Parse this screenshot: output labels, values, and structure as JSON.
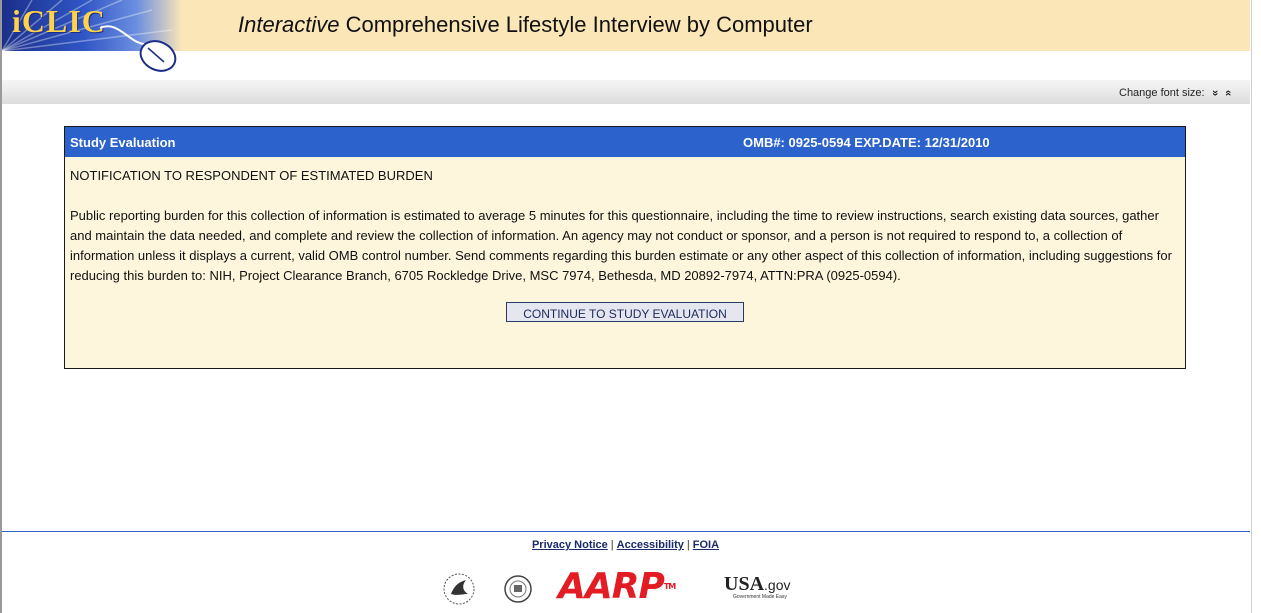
{
  "header": {
    "logo_text": "iCLIC",
    "title_italic": "Interactive",
    "title_rest": " Comprehensive Lifestyle Interview by Computer"
  },
  "toolbar": {
    "font_size_label": "Change font size:",
    "decrease_glyph": "»",
    "increase_glyph": "«"
  },
  "panel": {
    "title": "Study Evaluation",
    "omb": "OMB#: 0925-0594 EXP.DATE: 12/31/2010",
    "notice_heading": "NOTIFICATION TO RESPONDENT OF ESTIMATED BURDEN",
    "notice_text": "Public reporting burden for this collection of information is estimated to average 5 minutes for this questionnaire, including the time to review instructions, search existing data sources, gather and maintain the data needed, and complete and review the collection of information. An agency may not conduct or sponsor, and a person is not required to respond to, a collection of information unless it displays a current, valid OMB control number. Send comments regarding this burden estimate or any other aspect of this collection of information, including suggestions for reducing this burden to: NIH, Project Clearance Branch, 6705 Rockledge Drive, MSC 7974, Bethesda, MD 20892-7974, ATTN:PRA (0925-0594).",
    "continue_label": "CONTINUE TO STUDY EVALUATION"
  },
  "footer": {
    "links": [
      "Privacy Notice",
      "Accessibility",
      "FOIA"
    ],
    "separator": "|",
    "aarp_text": "AARP",
    "aarp_tm": "TM",
    "usagov_main": "USA",
    "usagov_suffix": ".gov",
    "usagov_tagline": "Government Made Easy"
  },
  "colors": {
    "header_bg": "#fbe6b8",
    "panel_head": "#2b62cc",
    "panel_bg": "#fdf5dc",
    "aarp_red": "#e31b23"
  }
}
